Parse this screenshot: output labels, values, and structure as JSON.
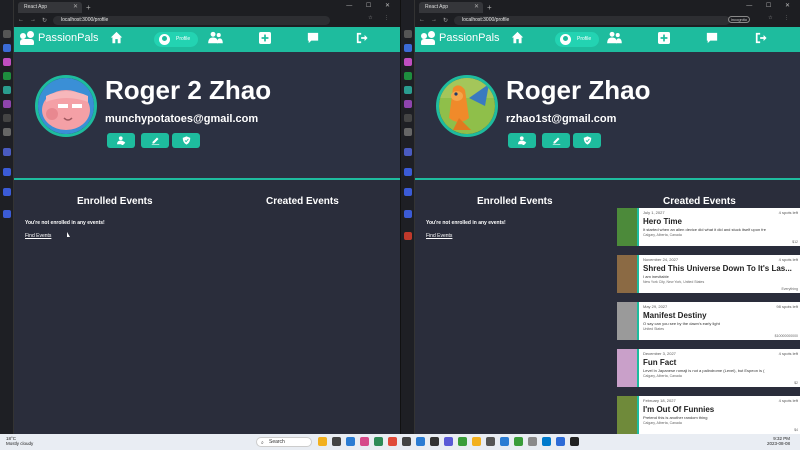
{
  "browser": {
    "tab_title": "React App",
    "url": "localhost:3000/profile",
    "incognito_label": "Incognito"
  },
  "app": {
    "brand": "PassionPals",
    "nav_profile_label": "Profile"
  },
  "left": {
    "profile": {
      "name": "Roger 2 Zhao",
      "email": "munchypotatoes@gmail.com"
    },
    "enrolled_heading": "Enrolled Events",
    "created_heading": "Created Events",
    "empty_message": "You're not enrolled in any events!",
    "find_events": "Find Events"
  },
  "right": {
    "profile": {
      "name": "Roger Zhao",
      "email": "rzhao1st@gmail.com"
    },
    "enrolled_heading": "Enrolled Events",
    "created_heading": "Created Events",
    "empty_message": "You're not enrolled in any events!",
    "find_events": "Find Events",
    "events": [
      {
        "date": "July 1, 2027",
        "spots": "4 spots left",
        "title": "Hero Time",
        "desc": "It started when an alien device did what it did and stuck itself upon fre",
        "loc": "Calgary, Alberta, Canada",
        "price": "$12",
        "thumb_color": "#4c8a3a"
      },
      {
        "date": "November 24, 2027",
        "spots": "4 spots left",
        "title": "Shred This Universe Down To It's Las...",
        "desc": "I am inevitable",
        "loc": "New York City, New York, United States",
        "price": "Everything",
        "thumb_color": "#8b6a44"
      },
      {
        "date": "May 29, 2027",
        "spots": "98 spots left",
        "title": "Manifest Destiny",
        "desc": "O say can you see by the dawn's early light",
        "loc": "United States",
        "price": "$10000000000",
        "thumb_color": "#9a9a9a"
      },
      {
        "date": "December 3, 2027",
        "spots": "4 spots left",
        "title": "Fun Fact",
        "desc": "Level in Japanese romaji is not a palindrome (Level), but Espeon is (",
        "loc": "Calgary, Alberta, Canada",
        "price": "$2",
        "thumb_color": "#c9a0c9"
      },
      {
        "date": "February 18, 2027",
        "spots": "4 spots left",
        "title": "I'm Out Of Funnies",
        "desc": "Pretend this is another random thing",
        "loc": "Calgary, Alberta, Canada",
        "price": "$4",
        "thumb_color": "#6f8a3a"
      }
    ]
  },
  "taskbar": {
    "weather_temp": "18°C",
    "weather_desc": "Mostly cloudy",
    "search_placeholder": "Search",
    "time": "9:32 PM",
    "date": "2023-08-08"
  },
  "colors": {
    "accent": "#1ebc9e",
    "page_bg": "#2a2d3b"
  }
}
